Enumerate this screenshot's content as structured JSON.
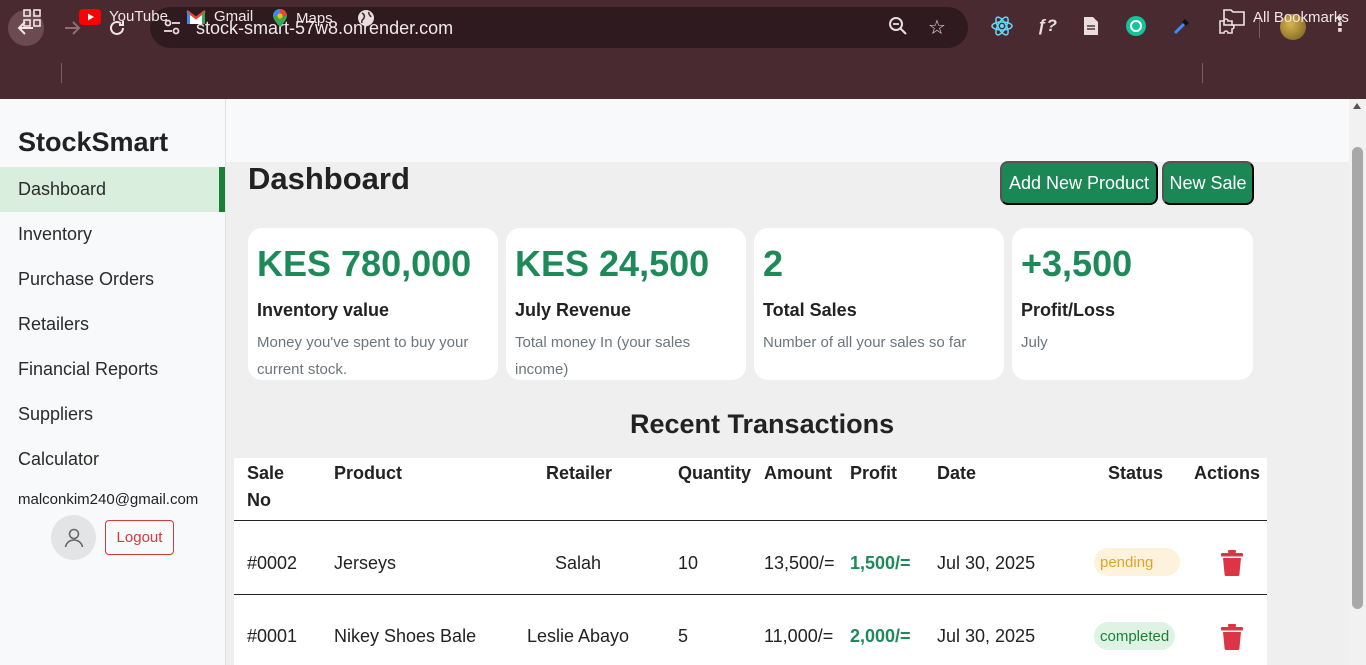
{
  "browser": {
    "url": "stock-smart-57w8.onrender.com",
    "bookmarks": [
      "YouTube",
      "Gmail",
      "Maps"
    ],
    "all_bookmarks": "All Bookmarks"
  },
  "app": {
    "brand": "StockSmart",
    "menu": [
      "Dashboard",
      "Inventory",
      "Purchase Orders",
      "Retailers",
      "Financial Reports",
      "Suppliers",
      "Calculator"
    ],
    "active_menu": "Dashboard",
    "user_email": "malconkim240@gmail.com",
    "logout_label": "Logout"
  },
  "dashboard": {
    "title": "Dashboard",
    "add_product_label": "Add New Product",
    "new_sale_label": "New Sale",
    "cards": [
      {
        "value": "KES 780,000",
        "label": "Inventory value",
        "desc": "Money you've spent to buy your current stock."
      },
      {
        "value": "KES 24,500",
        "label": "July Revenue",
        "desc": "Total money In (your sales income)"
      },
      {
        "value": "2",
        "label": "Total Sales",
        "desc": "Number of all your sales so far"
      },
      {
        "value": "+3,500",
        "label": "Profit/Loss",
        "desc": "July"
      }
    ]
  },
  "transactions": {
    "title": "Recent Transactions",
    "headers": {
      "sale_no": "Sale No",
      "product": "Product",
      "retailer": "Retailer",
      "quantity": "Quantity",
      "amount": "Amount",
      "profit": "Profit",
      "date": "Date",
      "status": "Status",
      "actions": "Actions"
    },
    "rows": [
      {
        "sale_no": "#0002",
        "product": "Jerseys",
        "retailer": "Salah",
        "quantity": "10",
        "amount": "13,500/=",
        "profit": "1,500/=",
        "date": "Jul 30, 2025",
        "status": "pending"
      },
      {
        "sale_no": "#0001",
        "product": "Nikey Shoes Bale",
        "retailer": "Leslie Abayo",
        "quantity": "5",
        "amount": "11,000/=",
        "profit": "2,000/=",
        "date": "Jul 30, 2025",
        "status": "completed"
      }
    ]
  },
  "colors": {
    "brand_green": "#1a8755",
    "value_green": "#1e8a5a",
    "danger": "#d33b3b",
    "chrome": "#4a2a31"
  }
}
